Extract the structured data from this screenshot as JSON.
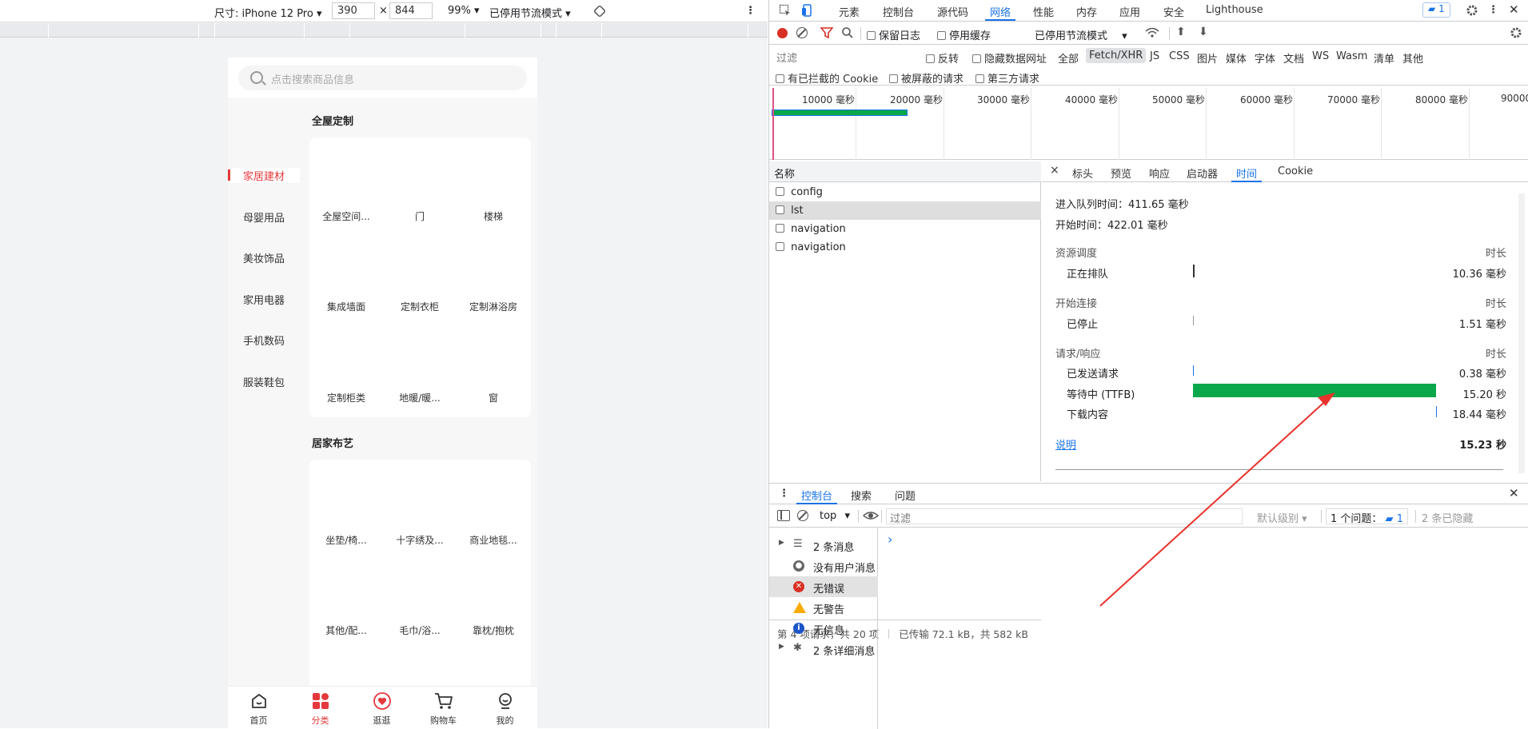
{
  "device_toolbar": {
    "device_label": "尺寸: iPhone 12 Pro",
    "width": "390",
    "times": "×",
    "height": "844",
    "zoom": "99%",
    "throttle": "已停用节流模式"
  },
  "phone": {
    "search_placeholder": "点击搜索商品信息",
    "categories": [
      {
        "label": "家居建材",
        "active": true
      },
      {
        "label": "母婴用品",
        "active": false
      },
      {
        "label": "美妆饰品",
        "active": false
      },
      {
        "label": "家用电器",
        "active": false
      },
      {
        "label": "手机数码",
        "active": false
      },
      {
        "label": "服装鞋包",
        "active": false
      }
    ],
    "section1": {
      "title": "全屋定制",
      "items": [
        "全屋空间...",
        "门",
        "楼梯",
        "集成墙面",
        "定制衣柜",
        "定制淋浴房",
        "定制柜类",
        "地暖/暖...",
        "窗"
      ]
    },
    "section2": {
      "title": "居家布艺",
      "items": [
        "坐垫/椅...",
        "十字绣及...",
        "商业地毯...",
        "其他/配...",
        "毛巾/浴...",
        "靠枕/抱枕"
      ]
    },
    "tabbar": [
      {
        "label": "首页",
        "icon": "home-icon",
        "active": false
      },
      {
        "label": "分类",
        "icon": "category-grid-icon",
        "active": true
      },
      {
        "label": "逛逛",
        "icon": "browse-heart-icon",
        "active": false
      },
      {
        "label": "购物车",
        "icon": "cart-icon",
        "active": false
      },
      {
        "label": "我的",
        "icon": "user-icon",
        "active": false
      }
    ],
    "accent_color": "#e4393c"
  },
  "devtools": {
    "tabs": [
      "元素",
      "控制台",
      "源代码",
      "网络",
      "性能",
      "内存",
      "应用",
      "安全",
      "Lighthouse"
    ],
    "active_tab": "网络",
    "issues_badge": "1",
    "network_toolbar": {
      "preserve_log": "保留日志",
      "disable_cache": "停用缓存",
      "throttle": "已停用节流模式"
    },
    "filter": {
      "placeholder": "过滤",
      "invert": "反转",
      "hide_data_urls": "隐藏数据网址",
      "types": [
        "全部",
        "Fetch/XHR",
        "JS",
        "CSS",
        "图片",
        "媒体",
        "字体",
        "文档",
        "WS",
        "Wasm",
        "清单",
        "其他"
      ],
      "active_type": "Fetch/XHR",
      "blocked_cookies": "有已拦截的 Cookie",
      "blocked_requests": "被屏蔽的请求",
      "third_party": "第三方请求"
    },
    "overview_ticks": [
      "10000 毫秒",
      "20000 毫秒",
      "30000 毫秒",
      "40000 毫秒",
      "50000 毫秒",
      "60000 毫秒",
      "70000 毫秒",
      "80000 毫秒",
      "90000"
    ],
    "request_list": {
      "header": "名称",
      "rows": [
        {
          "name": "config",
          "selected": false
        },
        {
          "name": "lst",
          "selected": true
        },
        {
          "name": "navigation",
          "selected": false
        },
        {
          "name": "navigation",
          "selected": false
        }
      ],
      "status": "第 4 项请求，共 20 项",
      "transferred": "已传输 72.1 kB，共 582 kB"
    },
    "detail": {
      "close": "×",
      "tabs": [
        "标头",
        "预览",
        "响应",
        "启动器",
        "时间",
        "Cookie"
      ],
      "active_tab": "时间",
      "queued_at": "进入队列时间：411.65 毫秒",
      "started_at": "开始时间：422.01 毫秒",
      "groups": [
        {
          "title": "资源调度",
          "col": "时长",
          "rows": [
            {
              "label": "正在排队",
              "value": "10.36 毫秒"
            }
          ]
        },
        {
          "title": "开始连接",
          "col": "时长",
          "rows": [
            {
              "label": "已停止",
              "value": "1.51 毫秒"
            }
          ]
        },
        {
          "title": "请求/响应",
          "col": "时长",
          "rows": [
            {
              "label": "已发送请求",
              "value": "0.38 毫秒"
            },
            {
              "label": "等待中 (TTFB)",
              "value": "15.20 秒"
            },
            {
              "label": "下载内容",
              "value": "18.44 毫秒"
            }
          ]
        }
      ],
      "explain_link": "说明",
      "total": "15.23 秒",
      "ttfb_color": "#0aa84a"
    },
    "drawer": {
      "tabs": [
        "控制台",
        "搜索",
        "问题"
      ],
      "active_tab": "控制台",
      "context": "top",
      "filter_placeholder": "过滤",
      "level": "默认级别",
      "issues": "1 个问题：",
      "issues_count": "1",
      "hidden": "2 条已隐藏",
      "sidebar": [
        {
          "label": "2 条消息",
          "icon": "list-icon"
        },
        {
          "label": "没有用户消息",
          "icon": "user-circle-icon"
        },
        {
          "label": "无错误",
          "icon": "error-icon"
        },
        {
          "label": "无警告",
          "icon": "warning-icon"
        },
        {
          "label": "无信息",
          "icon": "info-icon"
        },
        {
          "label": "2 条详细消息",
          "icon": "bug-icon"
        }
      ],
      "prompt": "›"
    }
  }
}
